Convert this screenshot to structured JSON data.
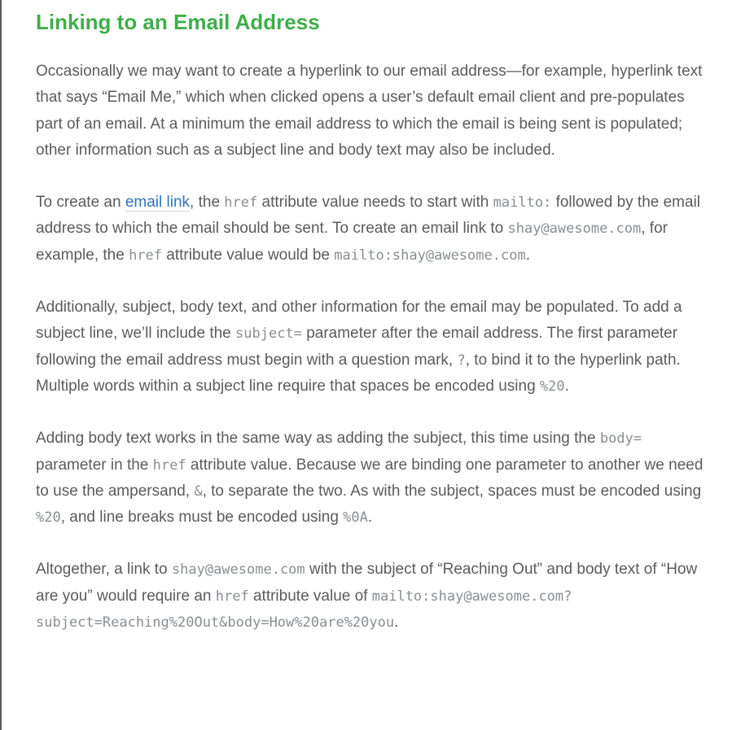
{
  "heading": "Linking to an Email Address",
  "p1": {
    "text": "Occasionally we may want to create a hyperlink to our email address—for example, hyperlink text that says “Email Me,” which when clicked opens a user’s default email client and pre-populates part of an email. At a minimum the email address to which the email is being sent is populated; other information such as a subject line and body text may also be included."
  },
  "p2": {
    "t1": "To create an ",
    "link": "email link",
    "t2": ", the ",
    "c1": "href",
    "t3": " attribute value needs to start with ",
    "c2": "mailto:",
    "t4": " followed by the email address to which the email should be sent. To create an email link to ",
    "c3": "shay@awesome.com",
    "t5": ", for example, the ",
    "c4": "href",
    "t6": " attribute value would be ",
    "c5": "mailto:shay@awesome.com",
    "t7": "."
  },
  "p3": {
    "t1": "Additionally, subject, body text, and other information for the email may be populated. To add a subject line, we’ll include the ",
    "c1": "subject=",
    "t2": " parameter after the email address. The first parameter following the email address must begin with a question mark, ",
    "c2": "?",
    "t3": ", to bind it to the hyperlink path. Multiple words within a subject line require that spaces be encoded using ",
    "c3": "%20",
    "t4": "."
  },
  "p4": {
    "t1": "Adding body text works in the same way as adding the subject, this time using the ",
    "c1": "body=",
    "t2": " parameter in the ",
    "c2": "href",
    "t3": " attribute value. Because we are binding one parameter to another we need to use the ampersand, ",
    "c3": "&",
    "t4": ", to separate the two. As with the subject, spaces must be encoded using ",
    "c4": "%20",
    "t5": ", and line breaks must be encoded using ",
    "c5": "%0A",
    "t6": "."
  },
  "p5": {
    "t1": "Altogether, a link to ",
    "c1": "shay@awesome.com",
    "t2": " with the subject of “Reaching Out” and body text of “How are you” would require an ",
    "c2": "href",
    "t3": " attribute value of ",
    "c3": "mailto:shay@awesome.com?subject=Reaching%20Out&body=How%20are%20you",
    "t4": "."
  }
}
